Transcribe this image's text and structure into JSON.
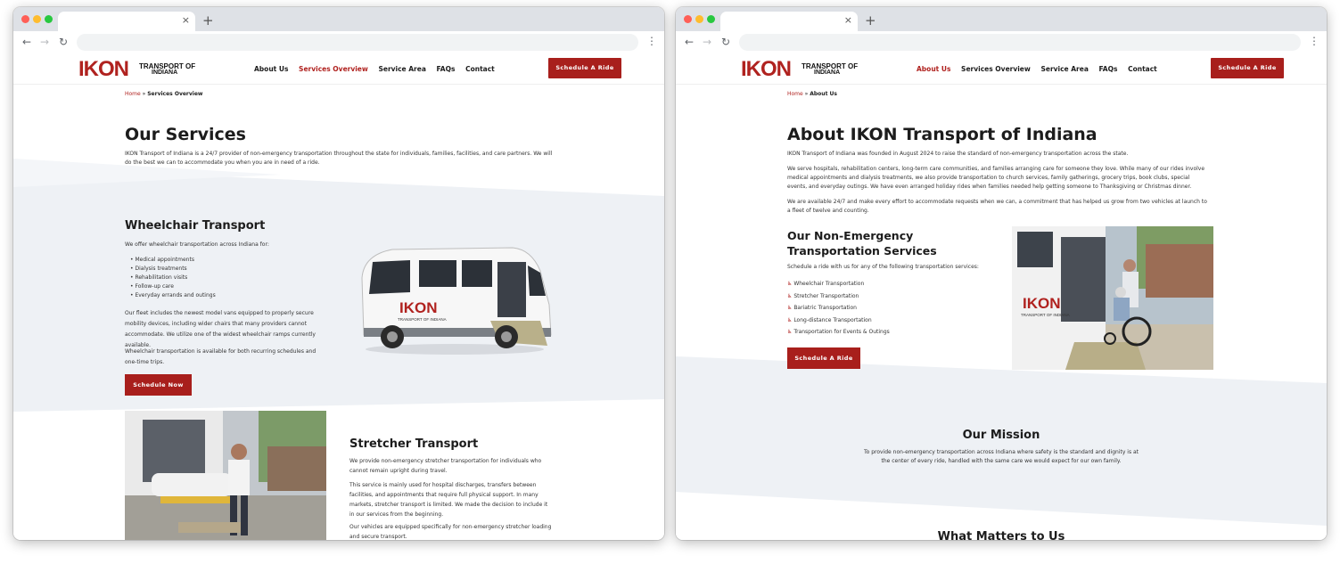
{
  "brand": {
    "logo_main": "IKON",
    "logo_sub1": "TRANSPORT OF",
    "logo_sub2": "INDIANA"
  },
  "browser": {
    "new_tab": "+",
    "close_tab": "×"
  },
  "nav": {
    "items": [
      "About Us",
      "Services Overview",
      "Service Area",
      "FAQs",
      "Contact"
    ],
    "cta": "Schedule A Ride"
  },
  "services_page": {
    "breadcrumb": [
      "Home",
      "»",
      "Services Overview"
    ],
    "title": "Our Services",
    "intro": "IKON Transport of Indiana is a 24/7 provider of non-emergency transportation throughout the state for individuals, families, facilities, and care partners. We will do the best we can to accommodate you when you are in need of a ride.",
    "wheelchair": {
      "heading": "Wheelchair Transport",
      "lead": "We offer wheelchair transportation across Indiana for:",
      "list": [
        "Medical appointments",
        "Dialysis treatments",
        "Rehabilitation visits",
        "Follow-up care",
        "Everyday errands and outings"
      ],
      "p1": "Our fleet includes the newest model vans equipped to properly secure mobility devices, including wider chairs that many providers cannot accommodate. We utilize one of the widest wheelchair ramps currently available.",
      "p2": "Wheelchair transportation is available for both recurring schedules and one-time trips.",
      "button": "Schedule Now",
      "van_logo": "IKON",
      "van_sub": "TRANSPORT OF INDIANA"
    },
    "stretcher": {
      "heading": "Stretcher Transport",
      "p1": "We provide non-emergency stretcher transportation for individuals who cannot remain upright during travel.",
      "p2": "This service is mainly used for hospital discharges, transfers between facilities, and appointments that require full physical support. In many markets, stretcher transport is limited. We made the decision to include it in our services from the beginning.",
      "p3": "Our vehicles are equipped specifically for non-emergency stretcher loading and secure transport."
    }
  },
  "about_page": {
    "breadcrumb": [
      "Home",
      "»",
      "About Us"
    ],
    "title": "About IKON Transport of Indiana",
    "p1": "IKON Transport of Indiana was founded in August 2024 to raise the standard of non-emergency transportation across the state.",
    "p2": "We serve hospitals, rehabilitation centers, long-term care communities, and families arranging care for someone they love. While many of our rides involve medical appointments and dialysis treatments, we also provide transportation to church services, family gatherings, grocery trips, book clubs, special events, and everyday outings. We have even arranged holiday rides when families needed help getting someone to Thanksgiving or Christmas dinner.",
    "p3": "We are available 24/7 and make every effort to accommodate requests when we can, a commitment that has helped us grow from two vehicles at launch to a fleet of twelve and counting.",
    "services_heading_1": "Our Non-Emergency",
    "services_heading_2": "Transportation Services",
    "services_lead": "Schedule a ride with us for any of the following transportation services:",
    "services_list": [
      "Wheelchair Transportation",
      "Stretcher Transportation",
      "Bariatric Transportation",
      "Long-distance Transportation",
      "Transportation for Events & Outings"
    ],
    "button": "Schedule A Ride",
    "mission_heading": "Our Mission",
    "mission_text": "To provide non-emergency transportation across Indiana where safety is the standard and dignity is at the center of every ride, handled with the same care we would expect for our own family.",
    "values_heading": "What Matters to Us",
    "van_logo": "IKON",
    "van_sub": "TRANSPORT OF INDIANA"
  },
  "colors": {
    "brand_red": "#a81f1c",
    "band": "#eef1f5"
  }
}
